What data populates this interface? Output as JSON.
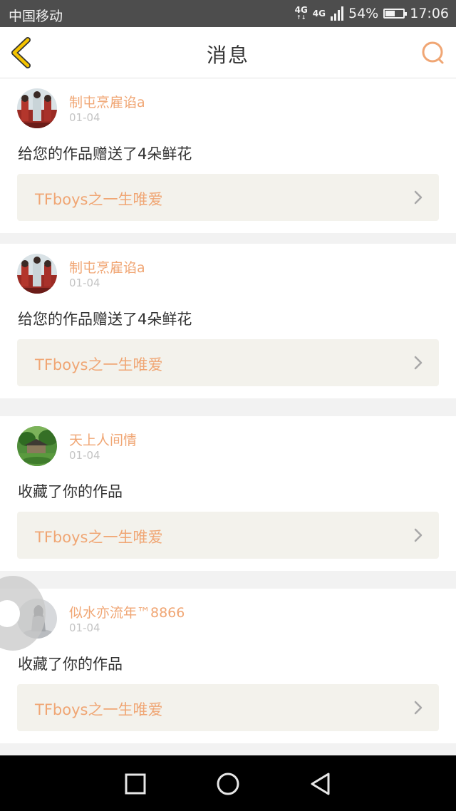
{
  "status_bar": {
    "carrier": "中国移动",
    "network_1": "4G",
    "network_2": "4G",
    "battery_percent": "54%",
    "battery_level": 0.54,
    "time": "17:06",
    "icons": [
      "signal-icon",
      "battery-icon"
    ]
  },
  "header": {
    "title": "消息",
    "back_icon": "chevron-left-icon",
    "search_icon": "search-icon"
  },
  "colors": {
    "accent": "#f0a674",
    "back_icon": "#f5c400",
    "status_bar_bg": "#4d4d4d",
    "card_bg": "#ffffff",
    "work_bg": "#f3f2ec",
    "nav_bar_bg": "#000000"
  },
  "messages": [
    {
      "username": "制屯烹雇谄a",
      "date": "01-04",
      "action": "给您的作品赠送了4朵鲜花",
      "work_title": "TFboys之一生唯爱",
      "avatar_icon": "group-photo-avatar"
    },
    {
      "username": "制屯烹雇谄a",
      "date": "01-04",
      "action": "给您的作品赠送了4朵鲜花",
      "work_title": "TFboys之一生唯爱",
      "avatar_icon": "group-photo-avatar"
    },
    {
      "username": "天上人间情",
      "date": "01-04",
      "action": "收藏了你的作品",
      "work_title": "TFboys之一生唯爱",
      "avatar_icon": "landscape-avatar"
    },
    {
      "username": "似水亦流年™8866",
      "date": "01-04",
      "action": "收藏了你的作品",
      "work_title": "TFboys之一生唯爱",
      "avatar_icon": "figure-avatar"
    }
  ],
  "nav_bar": {
    "recents_icon": "square-icon",
    "home_icon": "circle-icon",
    "back_icon": "triangle-back-icon"
  }
}
